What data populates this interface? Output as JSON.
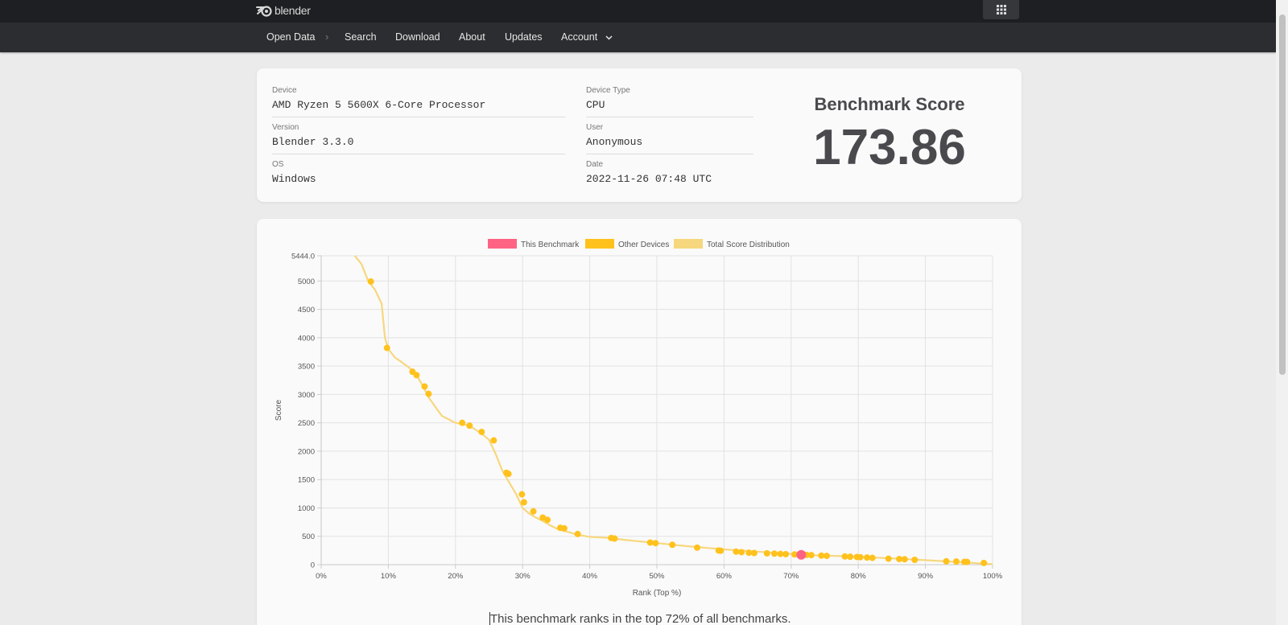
{
  "brand": {
    "name": "blender"
  },
  "nav": {
    "items": [
      {
        "label": "Open Data"
      },
      {
        "label": "Search"
      },
      {
        "label": "Download"
      },
      {
        "label": "About"
      },
      {
        "label": "Updates"
      },
      {
        "label": "Account"
      }
    ],
    "separator": "›"
  },
  "info": {
    "device_label": "Device",
    "device_value": "AMD Ryzen 5 5600X 6-Core Processor",
    "version_label": "Version",
    "version_value": "Blender 3.3.0",
    "os_label": "OS",
    "os_value": "Windows",
    "device_type_label": "Device Type",
    "device_type_value": "CPU",
    "user_label": "User",
    "user_value": "Anonymous",
    "date_label": "Date",
    "date_value": "2022-11-26 07:48 UTC",
    "score_title": "Benchmark Score",
    "score_value": "173.86"
  },
  "chart_data": {
    "type": "scatter",
    "xlabel": "Rank (Top %)",
    "ylabel": "Score",
    "xlim": [
      0,
      100
    ],
    "ylim": [
      0,
      5444
    ],
    "x_ticks": [
      "0%",
      "10%",
      "20%",
      "30%",
      "40%",
      "50%",
      "60%",
      "70%",
      "80%",
      "90%",
      "100%"
    ],
    "y_ticks": [
      "5444.0",
      "5000",
      "4500",
      "4000",
      "3500",
      "3000",
      "2500",
      "2000",
      "1500",
      "1000",
      "500",
      "0"
    ],
    "y_tick_values": [
      5444,
      5000,
      4500,
      4000,
      3500,
      3000,
      2500,
      2000,
      1500,
      1000,
      500,
      0
    ],
    "grid": true,
    "legend_position": "top",
    "legend": [
      {
        "name": "This Benchmark",
        "color": "#ff6384"
      },
      {
        "name": "Other Devices",
        "color": "#ffc21d"
      },
      {
        "name": "Total Score Distribution",
        "color": "#f7d77e"
      }
    ],
    "distribution": {
      "name": "Total Score Distribution",
      "x": [
        5,
        6,
        7,
        8,
        9,
        9.5,
        10,
        11,
        12,
        13,
        14,
        15,
        16,
        17,
        18,
        19,
        20,
        21,
        22,
        23,
        24,
        25,
        26,
        27,
        28,
        29,
        30,
        31,
        32,
        33,
        34,
        35,
        36,
        37,
        38,
        40,
        43,
        45,
        50,
        55,
        60,
        65,
        70,
        71,
        75,
        80,
        85,
        90,
        95,
        100
      ],
      "y": [
        5444,
        5300,
        5000,
        4850,
        4600,
        4000,
        3800,
        3650,
        3570,
        3480,
        3380,
        3180,
        2950,
        2780,
        2620,
        2560,
        2500,
        2480,
        2450,
        2380,
        2300,
        2200,
        1950,
        1650,
        1450,
        1250,
        1000,
        900,
        830,
        770,
        700,
        640,
        600,
        570,
        530,
        490,
        470,
        440,
        380,
        320,
        270,
        230,
        190,
        174,
        160,
        140,
        110,
        80,
        45,
        10
      ]
    },
    "other_devices": {
      "name": "Other Devices",
      "x": [
        7.4,
        9.8,
        13.6,
        14.2,
        15.4,
        16,
        21,
        22.1,
        23.9,
        25.7,
        27.6,
        27.9,
        29.9,
        30.2,
        31.6,
        33,
        33.7,
        35.6,
        36.2,
        38.2,
        43.2,
        43.7,
        49,
        49.8,
        52.3,
        56,
        59.2,
        59.5,
        61.8,
        62.6,
        63.7,
        64.5,
        66.4,
        67.5,
        68.4,
        69.2,
        70.5,
        72.3,
        73,
        74.5,
        75.3,
        78,
        78.8,
        79.8,
        80.3,
        81.3,
        82.1,
        84.5,
        86.1,
        86.9,
        88.4,
        93.1,
        94.6,
        95.8,
        96.2,
        98.7
      ],
      "y": [
        4990,
        3820,
        3400,
        3340,
        3140,
        3010,
        2500,
        2450,
        2340,
        2190,
        1620,
        1600,
        1240,
        1100,
        940,
        830,
        790,
        650,
        640,
        540,
        470,
        460,
        390,
        380,
        350,
        300,
        250,
        245,
        230,
        220,
        210,
        205,
        200,
        195,
        190,
        185,
        180,
        172,
        168,
        160,
        155,
        145,
        140,
        135,
        132,
        125,
        120,
        105,
        100,
        95,
        85,
        60,
        55,
        50,
        48,
        30
      ]
    },
    "this_benchmark": {
      "name": "This Benchmark",
      "x": 71.5,
      "y": 173.86
    }
  },
  "summary": "This benchmark ranks in the top 72% of all benchmarks."
}
